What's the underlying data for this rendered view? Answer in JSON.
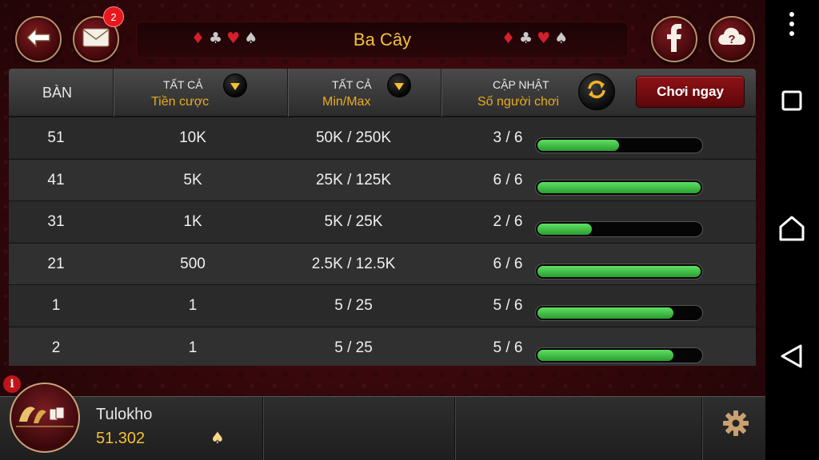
{
  "header": {
    "title": "Ba Cây",
    "mail_badge": "2",
    "suits_left": [
      "♦",
      "♣",
      "♥",
      "♠"
    ],
    "suits_right": [
      "♦",
      "♣",
      "♥",
      "♠"
    ]
  },
  "table": {
    "col_ban": "BÀN",
    "col_bet_label": "TẤT CẢ",
    "col_bet_sub": "Tiền cược",
    "col_minmax_label": "TẤT CẢ",
    "col_minmax_sub": "Min/Max",
    "col_players_label": "CẬP NHẬT",
    "col_players_sub": "Số người chơi",
    "play_now": "Chơi ngay",
    "rows": [
      {
        "ban": "51",
        "bet": "10K",
        "minmax": "50K / 250K",
        "players": "3 / 6",
        "fill": 0.5
      },
      {
        "ban": "41",
        "bet": "5K",
        "minmax": "25K / 125K",
        "players": "6 / 6",
        "fill": 1.0
      },
      {
        "ban": "31",
        "bet": "1K",
        "minmax": "5K / 25K",
        "players": "2 / 6",
        "fill": 0.333
      },
      {
        "ban": "21",
        "bet": "500",
        "minmax": "2.5K / 12.5K",
        "players": "6 / 6",
        "fill": 1.0
      },
      {
        "ban": "1",
        "bet": "1",
        "minmax": "5 / 25",
        "players": "5 / 6",
        "fill": 0.833
      },
      {
        "ban": "2",
        "bet": "1",
        "minmax": "5 / 25",
        "players": "5 / 6",
        "fill": 0.833
      }
    ]
  },
  "player": {
    "name": "Tulokho",
    "balance": "51.302",
    "info_mark": "i"
  },
  "colors": {
    "accent_gold": "#f3c230",
    "progress_green": "#3cc444",
    "button_red": "#8e1216"
  },
  "icons": {
    "back": "back-arrow-icon",
    "mail": "mail-icon",
    "facebook": "facebook-icon",
    "help": "help-cloud-icon",
    "refresh": "refresh-icon",
    "settings": "gear-icon",
    "currency": "spade-icon"
  }
}
